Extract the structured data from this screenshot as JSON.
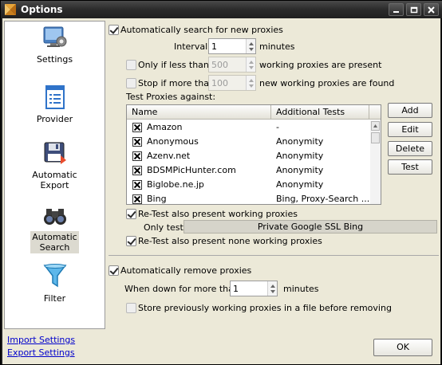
{
  "window": {
    "title": "Options"
  },
  "sidebar": {
    "items": [
      {
        "label": "Settings",
        "icon": "settings-icon"
      },
      {
        "label": "Provider",
        "icon": "document-icon"
      },
      {
        "label": "Automatic\nExport",
        "label_lines": [
          "Automatic",
          "Export"
        ],
        "icon": "floppy-disk-icon"
      },
      {
        "label_lines": [
          "Automatic",
          "Search"
        ],
        "icon": "binoculars-icon",
        "active": true
      },
      {
        "label": "Filter",
        "icon": "funnel-icon"
      }
    ],
    "import_settings": "Import Settings",
    "export_settings": "Export Settings"
  },
  "auto_search": {
    "label": "Automatically search for new proxies",
    "checked": true,
    "interval_label": "Interval",
    "interval_value": "1",
    "interval_unit": "minutes",
    "only_if_less_label": "Only if less than",
    "only_if_less_value": "500",
    "only_if_less_suffix": "working proxies are present",
    "stop_if_more_label": "Stop if more than",
    "stop_if_more_value": "100",
    "stop_if_more_suffix": "new working proxies are found",
    "test_against_label": "Test Proxies against:"
  },
  "table": {
    "columns": [
      "Name",
      "Additional Tests"
    ],
    "rows": [
      {
        "name": "Amazon",
        "tests": "-"
      },
      {
        "name": "Anonymous",
        "tests": "Anonymity"
      },
      {
        "name": "Azenv.net",
        "tests": "Anonymity"
      },
      {
        "name": "BDSMPicHunter.com",
        "tests": "Anonymity"
      },
      {
        "name": "Biglobe.ne.jp",
        "tests": "Anonymity"
      },
      {
        "name": "Bing",
        "tests": "Bing, Proxy-Search ..."
      }
    ]
  },
  "side_buttons": {
    "add": "Add",
    "edit": "Edit",
    "delete": "Delete",
    "test": "Test"
  },
  "retest": {
    "working_label": "Re-Test also present working proxies",
    "only_test_label": "Only test",
    "only_test_value": "Private Google SSL Bing",
    "none_working_label": "Re-Test also present none working proxies"
  },
  "auto_remove": {
    "label": "Automatically remove proxies",
    "when_down_label": "When down for more than",
    "when_down_value": "1",
    "when_down_unit": "minutes",
    "store_label": "Store previously working proxies in a file before removing"
  },
  "ok_label": "OK",
  "colors": {
    "titlebar": "#2b2b2b",
    "client": "#ece9d8",
    "link": "#0000cc"
  }
}
